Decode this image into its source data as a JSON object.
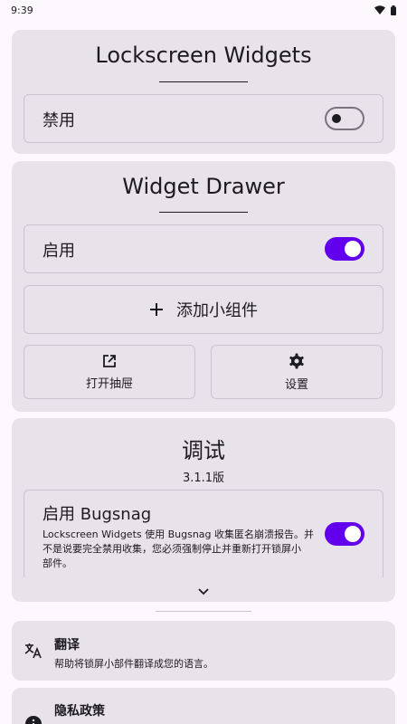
{
  "status_bar": {
    "time": "9:39"
  },
  "lockscreen_card": {
    "title": "Lockscreen Widgets",
    "toggle_label": "禁用",
    "toggle_on": false
  },
  "drawer_card": {
    "title": "Widget Drawer",
    "toggle_label": "启用",
    "toggle_on": true,
    "add_button_label": "添加小组件",
    "open_drawer_label": "打开抽屉",
    "settings_label": "设置"
  },
  "debug_card": {
    "title": "调试",
    "version": "3.1.1版",
    "bugsnag_title": "启用 Bugsnag",
    "bugsnag_desc_line1": "Lockscreen Widgets 使用 Bugsnag 收集匿名崩溃报告。并",
    "bugsnag_desc_line2": "不是说要完全禁用收集，您必须强制停止并重新打开锁屏小",
    "bugsnag_desc_line3": "部件。",
    "bugsnag_on": true
  },
  "translate_card": {
    "title": "翻译",
    "desc": "帮助将锁屏小部件翻译成您的语言。"
  },
  "privacy_card": {
    "title": "隐私政策"
  },
  "colors": {
    "accent": "#6200ee",
    "card_bg": "#e8e2ea",
    "page_bg": "#fdf8fd"
  }
}
